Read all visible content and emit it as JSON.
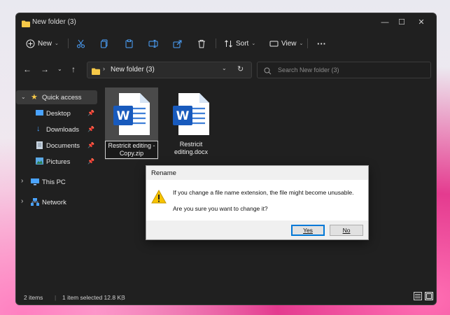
{
  "window": {
    "title": "New folder (3)",
    "minimize": "—",
    "maximize": "☐",
    "close": "✕"
  },
  "toolbar": {
    "new_label": "New",
    "sort_label": "Sort",
    "view_label": "View",
    "more_label": "···"
  },
  "address": {
    "path": "New folder (3)",
    "search_placeholder": "Search New folder (3)"
  },
  "sidebar": {
    "items": [
      {
        "label": "Quick access",
        "icon": "star-icon"
      },
      {
        "label": "Desktop",
        "icon": "desktop-icon"
      },
      {
        "label": "Downloads",
        "icon": "download-icon"
      },
      {
        "label": "Documents",
        "icon": "document-icon"
      },
      {
        "label": "Pictures",
        "icon": "pictures-icon"
      },
      {
        "label": "This PC",
        "icon": "computer-icon"
      },
      {
        "label": "Network",
        "icon": "network-icon"
      }
    ]
  },
  "files": [
    {
      "name_line1": "Restricit editing -",
      "name_line2": "Copy.zip",
      "icon": "word-document-icon",
      "selected": true
    },
    {
      "name_line1": "Restricit",
      "name_line2": "editing.docx",
      "icon": "word-document-icon",
      "selected": false
    }
  ],
  "status": {
    "items": "2 items",
    "selected": "1 item selected  12.8 KB"
  },
  "dialog": {
    "title": "Rename",
    "message": "If you change a file name extension, the file might become unusable.",
    "question": "Are you sure you want to change it?",
    "yes_label": "Yes",
    "no_label": "No"
  },
  "colors": {
    "window_bg": "#202020",
    "accent": "#0078d7",
    "word_blue": "#185abd",
    "folder_yellow": "#f7c948"
  }
}
